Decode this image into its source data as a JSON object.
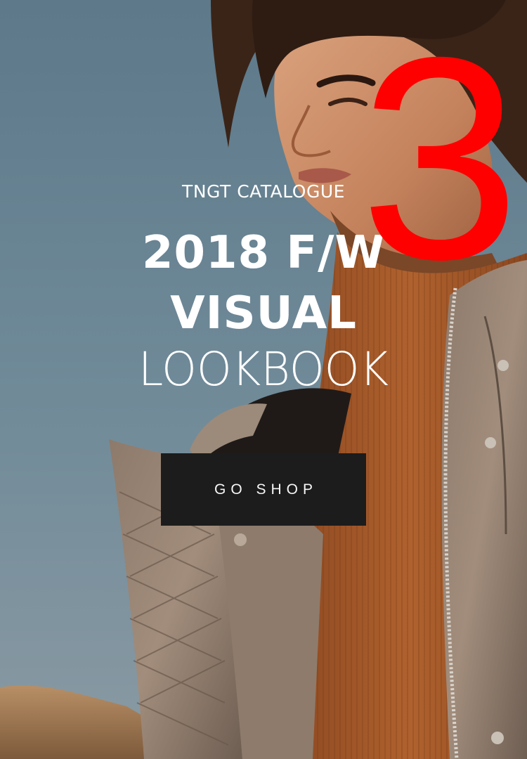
{
  "hero": {
    "eyebrow": "TNGT CATALOGUE",
    "title_line_1": "2018 F/W",
    "title_line_2": "VISUAL",
    "subtitle": "LOOKBOOK",
    "cta_label": "GO SHOP",
    "slide_number": "3"
  },
  "colors": {
    "sky": "#6c8797",
    "cta_background": "#1c1c1c",
    "cta_text": "#f6f6f6",
    "slide_number": "#ff0000"
  }
}
